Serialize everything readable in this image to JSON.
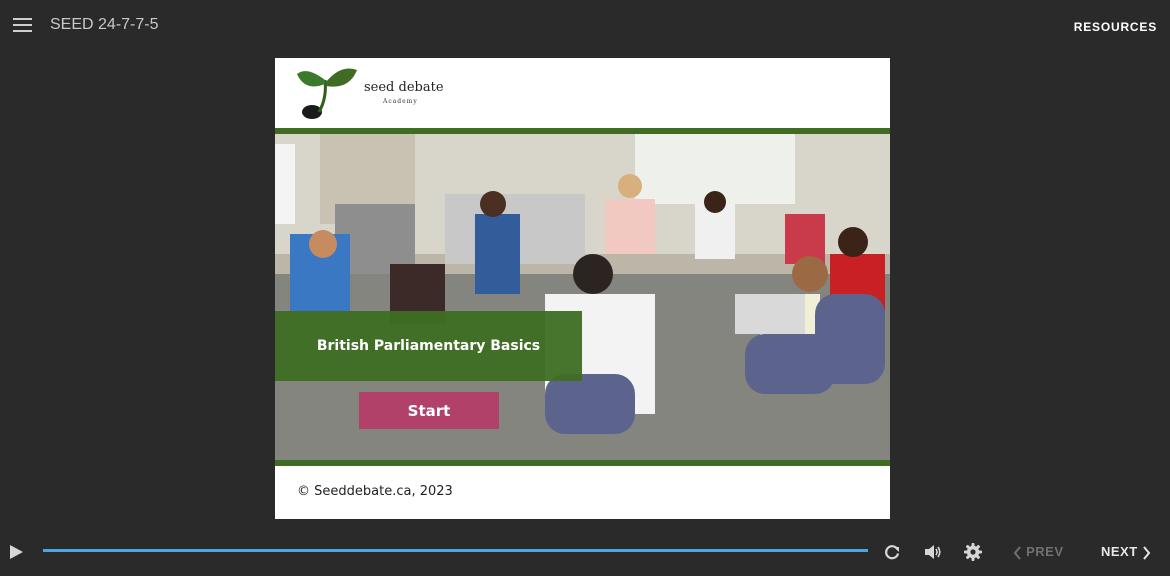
{
  "header": {
    "course_title": "SEED 24-7-7-5",
    "resources_label": "RESOURCES"
  },
  "slide": {
    "logo": {
      "name": "seed debate",
      "subtitle": "Academy"
    },
    "title": "British Parliamentary Basics",
    "start_label": "Start",
    "footer": "© Seeddebate.ca, 2023"
  },
  "player": {
    "prev_label": "PREV",
    "next_label": "NEXT",
    "progress": 1.0
  },
  "colors": {
    "background": "#2a2a2a",
    "brand_green": "#3f6b23",
    "title_green": "#3e6e22",
    "start_button": "#b2416a",
    "seekbar": "#4fa6dc"
  },
  "icons": [
    "menu-icon",
    "play-icon",
    "replay-icon",
    "volume-icon",
    "gear-icon",
    "chevron-left-icon",
    "chevron-right-icon",
    "seedling-logo-icon"
  ]
}
